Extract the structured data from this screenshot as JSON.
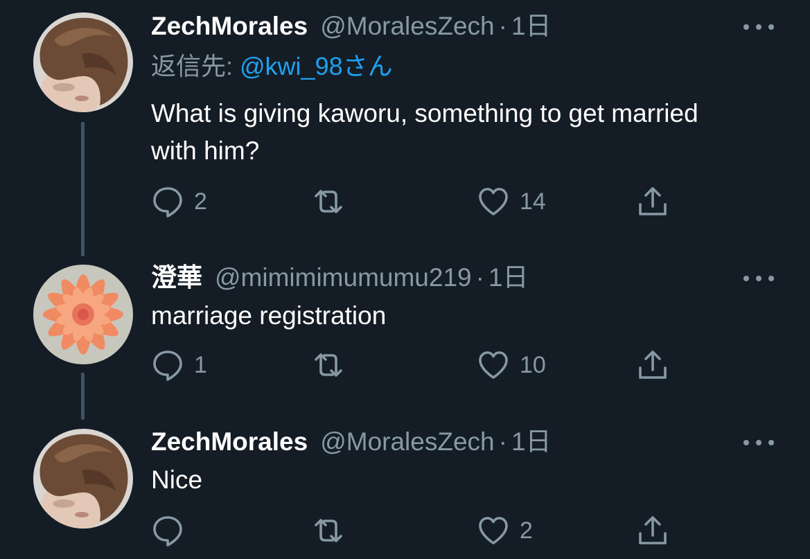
{
  "tweets": [
    {
      "display_name": "ZechMorales",
      "handle": "@MoralesZech",
      "separator": "·",
      "time": "1日",
      "reply_prefix": "返信先: ",
      "reply_to": "@kwi_98さん",
      "text": "What is giving kaworu, something to get married with him?",
      "replies": "2",
      "retweets": "",
      "likes": "14",
      "avatar": "person-brown-hair-avatar"
    },
    {
      "display_name": "澄華",
      "handle": "@mimimimumumu219",
      "separator": "·",
      "time": "1日",
      "text": "marriage registration",
      "replies": "1",
      "retweets": "",
      "likes": "10",
      "avatar": "orange-dahlia-avatar"
    },
    {
      "display_name": "ZechMorales",
      "handle": "@MoralesZech",
      "separator": "·",
      "time": "1日",
      "text": "Nice",
      "replies": "",
      "retweets": "",
      "likes": "2",
      "avatar": "person-brown-hair-avatar"
    }
  ],
  "icons": {
    "reply": "reply-icon",
    "retweet": "retweet-icon",
    "like": "heart-icon",
    "share": "share-icon",
    "more": "more-icon"
  },
  "colors": {
    "background": "#141d26",
    "secondary_text": "#8899a6",
    "link": "#1da1f2",
    "thread_line": "#3d5466"
  }
}
